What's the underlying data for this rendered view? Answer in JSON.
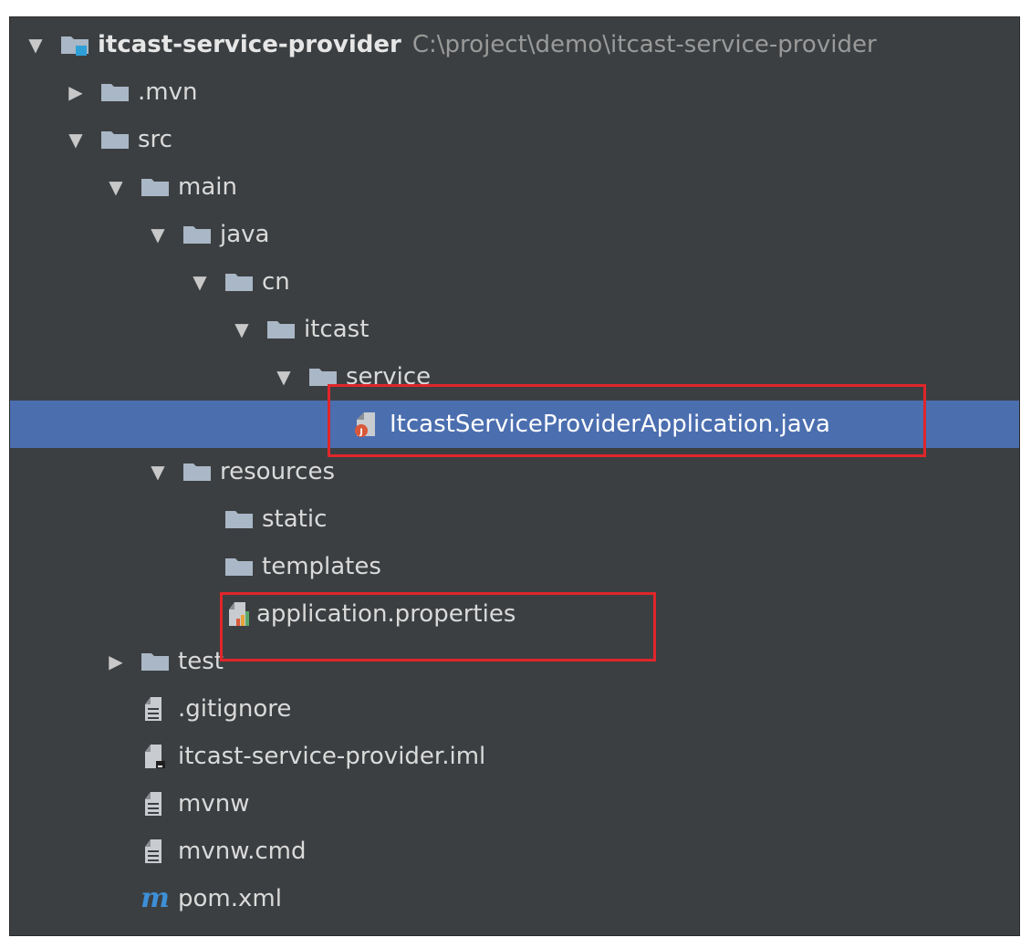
{
  "tree": {
    "items": [
      {
        "label": "itcast-service-provider",
        "path": "C:\\project\\demo\\itcast-service-provider",
        "arrow": "down",
        "icon": "module-folder-icon",
        "bold": true
      },
      {
        "label": ".mvn",
        "arrow": "right",
        "icon": "folder-icon"
      },
      {
        "label": "src",
        "arrow": "down",
        "icon": "folder-icon"
      },
      {
        "label": "main",
        "arrow": "down",
        "icon": "folder-icon"
      },
      {
        "label": "java",
        "arrow": "down",
        "icon": "folder-icon"
      },
      {
        "label": "cn",
        "arrow": "down",
        "icon": "folder-icon"
      },
      {
        "label": "itcast",
        "arrow": "down",
        "icon": "folder-icon"
      },
      {
        "label": "service",
        "arrow": "down",
        "icon": "folder-icon"
      },
      {
        "label": "ItcastServiceProviderApplication.java",
        "arrow": "none",
        "icon": "java-class-icon",
        "selected": true
      },
      {
        "label": "resources",
        "arrow": "down",
        "icon": "folder-icon"
      },
      {
        "label": "static",
        "arrow": "none",
        "icon": "folder-icon"
      },
      {
        "label": "templates",
        "arrow": "none",
        "icon": "folder-icon"
      },
      {
        "label": "application.properties",
        "arrow": "none",
        "icon": "properties-file-icon"
      },
      {
        "label": "test",
        "arrow": "right",
        "icon": "folder-icon"
      },
      {
        "label": ".gitignore",
        "arrow": "none",
        "icon": "text-file-icon"
      },
      {
        "label": "itcast-service-provider.iml",
        "arrow": "none",
        "icon": "iml-file-icon"
      },
      {
        "label": "mvnw",
        "arrow": "none",
        "icon": "text-file-icon"
      },
      {
        "label": "mvnw.cmd",
        "arrow": "none",
        "icon": "text-file-icon"
      },
      {
        "label": "pom.xml",
        "arrow": "none",
        "icon": "maven-pom-icon"
      }
    ]
  },
  "colors": {
    "background": "#3c3f41",
    "selection": "#4b6eaf",
    "highlight": "#e0262a",
    "folder": "#a9b7c6",
    "maven": "#3d8fd6"
  }
}
